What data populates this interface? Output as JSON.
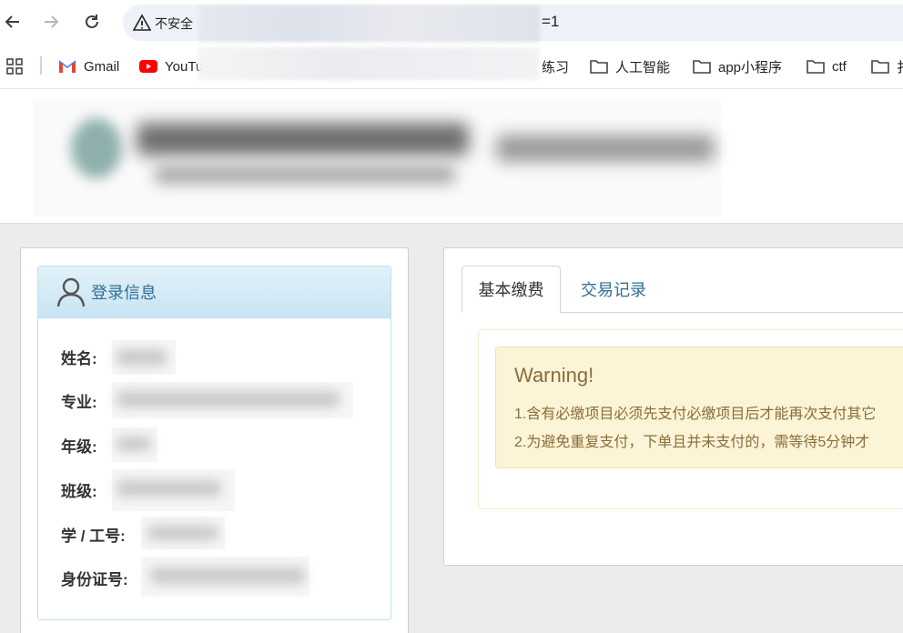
{
  "browser": {
    "security_label": "不安全",
    "url_visible_tail": "=1",
    "bookmarks": [
      {
        "label": "Gmail"
      },
      {
        "label": "YouTu"
      },
      {
        "label": "练习"
      },
      {
        "label": "人工智能"
      },
      {
        "label": "app小程序"
      },
      {
        "label": "ctf"
      },
      {
        "label": "扌"
      }
    ]
  },
  "login_info": {
    "title": "登录信息",
    "fields": [
      {
        "label": "姓名:"
      },
      {
        "label": "专业:"
      },
      {
        "label": "年级:"
      },
      {
        "label": "班级:"
      },
      {
        "label": "学 / 工号:"
      },
      {
        "label": "身份证号:"
      }
    ]
  },
  "tabs": [
    {
      "label": "基本缴费"
    },
    {
      "label": "交易记录"
    }
  ],
  "warning": {
    "title": "Warning!",
    "line1": "1.含有必缴项目必须先支付必缴项目后才能再次支付其它",
    "line2": "2.为避免重复支付，下单且并未支付的，需等待5分钟才"
  },
  "colors": {
    "accent_link": "#2f6f95",
    "warning_text": "#8a6d3b",
    "warning_bg": "#fcf4d6"
  }
}
